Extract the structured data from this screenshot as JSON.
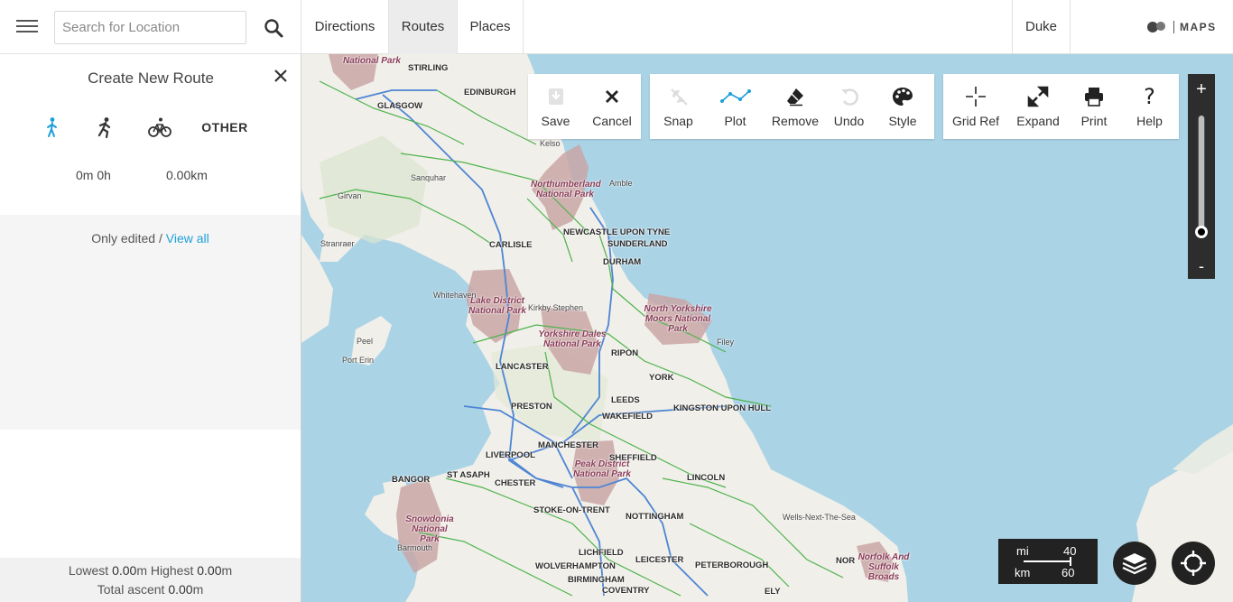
{
  "header": {
    "search_placeholder": "Search for Location",
    "tabs": [
      {
        "label": "Directions"
      },
      {
        "label": "Routes",
        "active": true
      },
      {
        "label": "Places"
      }
    ],
    "user": "Duke",
    "brand": "MAPS"
  },
  "sidebar": {
    "title": "Create New Route",
    "modes": [
      "walk-icon",
      "run-icon",
      "bike-icon",
      "OTHER"
    ],
    "active_mode": "walk",
    "duration": "0m 0h",
    "distance": "0.00km",
    "filter_text": "Only edited / ",
    "filter_link": "View all",
    "lowest_label": "Lowest",
    "lowest_value": "0.00",
    "highest_label": "Highest",
    "highest_value": "0.00",
    "ascent_label": "Total ascent",
    "ascent_value": "0.00",
    "unit": "m"
  },
  "toolbar": {
    "group1": [
      {
        "label": "Save",
        "icon": "save-icon"
      },
      {
        "label": "Cancel",
        "icon": "close-icon"
      }
    ],
    "group2": [
      {
        "label": "Snap",
        "icon": "snap-icon"
      },
      {
        "label": "Plot",
        "icon": "plot-icon"
      },
      {
        "label": "Remove",
        "icon": "eraser-icon"
      },
      {
        "label": "Undo",
        "icon": "undo-icon"
      },
      {
        "label": "Style",
        "icon": "palette-icon"
      }
    ],
    "group3": [
      {
        "label": "Grid Ref",
        "icon": "crosshair-icon"
      },
      {
        "label": "Expand",
        "icon": "expand-icon"
      },
      {
        "label": "Print",
        "icon": "print-icon"
      },
      {
        "label": "Help",
        "icon": "help-icon"
      }
    ]
  },
  "zoom": {
    "plus": "+",
    "minus": "-",
    "level_fraction": 0.05
  },
  "scale": {
    "mi_label": "mi",
    "mi_value": "40",
    "km_label": "km",
    "km_value": "60"
  },
  "map": {
    "water_color": "#aad3e6",
    "land_color": "#f1efe9",
    "park_color": "#c9a6a6",
    "labels": {
      "stirling": "STIRLING",
      "edinburgh": "EDINBURGH",
      "glasgow": "GLASGOW",
      "kelso": "Kelso",
      "sanquhar": "Sanquhar",
      "girvan": "Girvan",
      "amble": "Amble",
      "newcastle": "NEWCASTLE UPON TYNE",
      "sunderland": "SUNDERLAND",
      "stranraer": "Stranraer",
      "carlisle": "CARLISLE",
      "durham": "DURHAM",
      "whitehaven": "Whitehaven",
      "kirkby": "Kirkby Stephen",
      "filey": "Filey",
      "peel": "Peel",
      "port_erin": "Port Erin",
      "ripon": "RIPON",
      "lancaster": "LANCASTER",
      "york": "YORK",
      "leeds": "LEEDS",
      "preston": "PRESTON",
      "kingston": "KINGSTON UPON HULL",
      "wakefield": "WAKEFIELD",
      "manchester": "MANCHESTER",
      "liverpool": "LIVERPOOL",
      "sheffield": "SHEFFIELD",
      "bangor": "BANGOR",
      "st_asaph": "ST ASAPH",
      "lincoln": "LINCOLN",
      "chester": "CHESTER",
      "stoke": "STOKE-ON-TRENT",
      "nottingham": "NOTTINGHAM",
      "wells": "Wells-Next-The-Sea",
      "barmouth": "Barmouth",
      "lichfield": "LICHFIELD",
      "leicester": "LEICESTER",
      "norw": "NOR",
      "wolverhampton": "WOLVERHAMPTON",
      "peterborough": "PETERBOROUGH",
      "birmingham": "BIRMINGHAM",
      "coventry": "COVENTRY",
      "ely": "ELY"
    },
    "parks": {
      "trossachs": "National Park",
      "northumberland": "Northumberland National Park",
      "lake": "Lake District National Park",
      "yorkshire_dales": "Yorkshire Dales National Park",
      "north_york": "North Yorkshire Moors National Park",
      "peak": "Peak District National Park",
      "snowdonia": "Snowdonia National Park",
      "norfolk": "Norfolk And Suffolk Broads"
    }
  }
}
